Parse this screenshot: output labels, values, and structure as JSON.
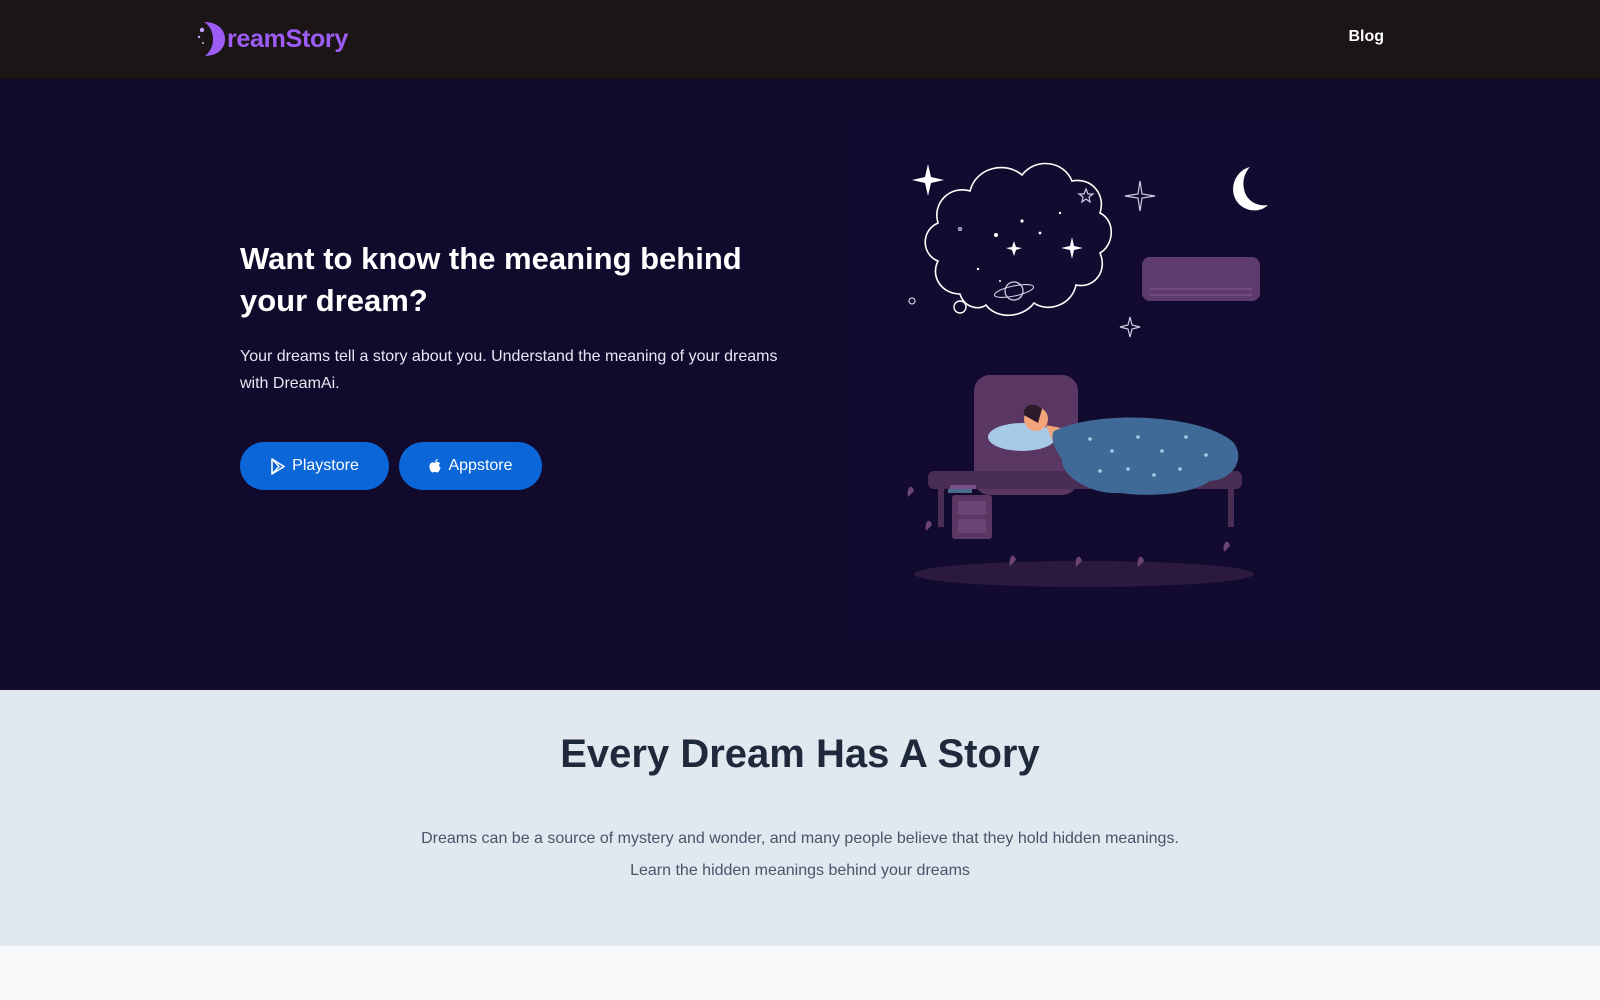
{
  "navbar": {
    "logo_text": "reamStory",
    "blog_label": "Blog"
  },
  "hero": {
    "title": "Want to know the meaning behind your dream?",
    "subtitle": "Your dreams tell a story about you. Understand the meaning of your dreams with DreamAi.",
    "buttons": {
      "playstore_label": "Playstore",
      "appstore_label": "Appstore"
    }
  },
  "story": {
    "title": "Every Dream Has A Story",
    "line1": "Dreams can be a source of mystery and wonder, and many people believe that they hold hidden meanings.",
    "line2": "Learn the hidden meanings behind your dreams"
  },
  "colors": {
    "navbar_bg": "#1b1516",
    "hero_bg": "#120a2d",
    "brand_purple": "#9d5cf5",
    "button_blue": "#0b66d8",
    "story_bg": "#e2e8f0",
    "story_title": "#1e293b"
  },
  "icons": {
    "logo": "crescent-moon-logo-icon",
    "playstore": "play-triangle-icon",
    "appstore": "apple-icon"
  }
}
